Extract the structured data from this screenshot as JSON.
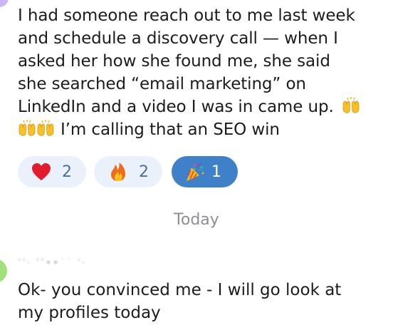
{
  "message": {
    "lines": [
      "I had someone reach out to me last week",
      "and schedule a discovery call — when I",
      "asked her how she found me, she said",
      "she searched “email marketing” on",
      "LinkedIn and a video I was in came up.",
      "I’m calling that an SEO win"
    ],
    "inline_emoji": "raising-hands-emoji"
  },
  "reactions": [
    {
      "icon": "red-heart-icon",
      "count": "2",
      "selected": false
    },
    {
      "icon": "fire-icon",
      "count": "2",
      "selected": false
    },
    {
      "icon": "party-popper-icon",
      "count": "1",
      "selected": true
    }
  ],
  "colors": {
    "reaction_bg": "#eaf1fb",
    "reaction_selected_bg": "#3f81c8",
    "reaction_count": "#4a6f9c",
    "date_divider": "#8e8e93",
    "avatar_top": "#c9b6f2",
    "avatar_bottom": "#a3df7b"
  },
  "date_divider": "Today",
  "reply": {
    "sender_name": "ʻʻ· ‘’••˙˙ ‘·",
    "lines": [
      "Ok- you convinced me - I will go look at",
      "my profiles today"
    ]
  }
}
